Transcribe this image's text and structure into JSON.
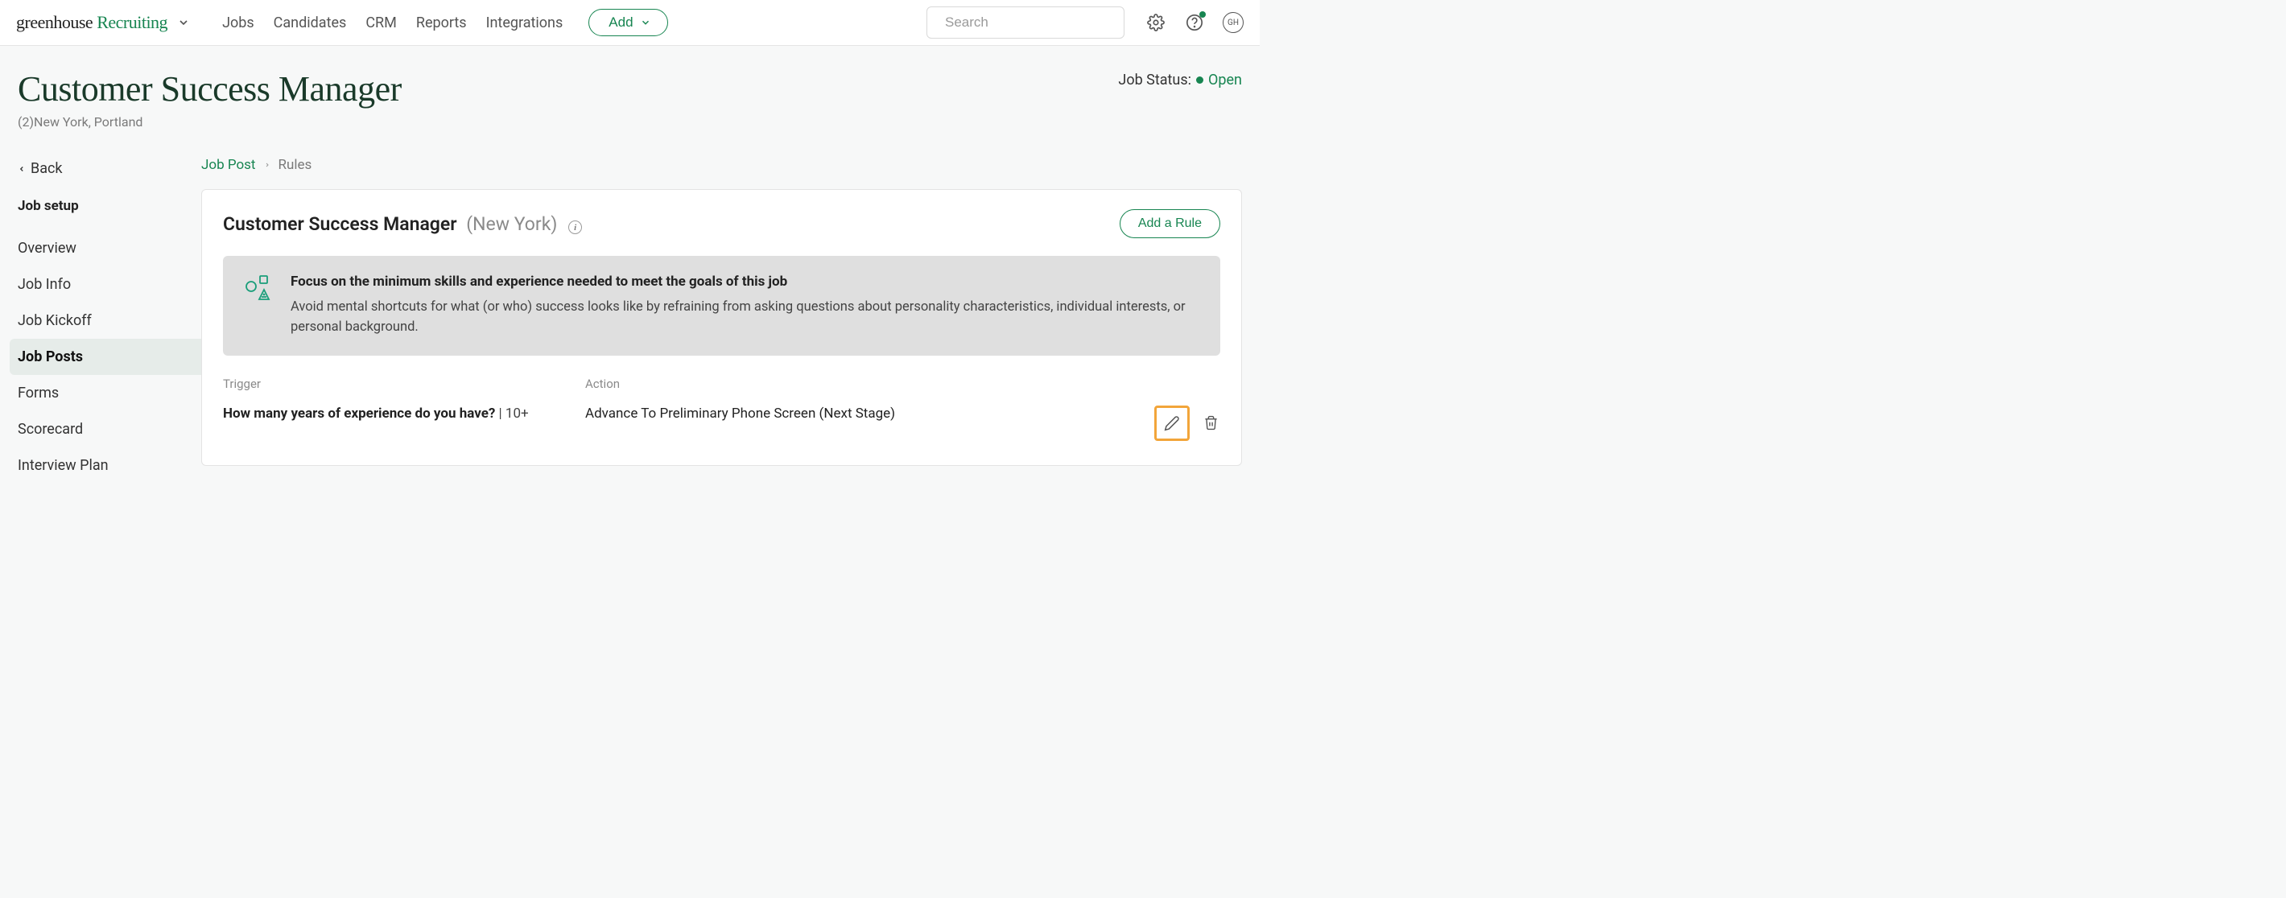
{
  "logo": {
    "word1": "greenhouse",
    "word2": "Recruiting"
  },
  "nav": {
    "jobs": "Jobs",
    "candidates": "Candidates",
    "crm": "CRM",
    "reports": "Reports",
    "integrations": "Integrations"
  },
  "add_button": "Add",
  "search": {
    "placeholder": "Search"
  },
  "avatar": "GH",
  "page": {
    "title": "Customer Success Manager",
    "subtitle": "(2)New York, Portland",
    "status_label": "Job Status:",
    "status_value": "Open"
  },
  "sidebar": {
    "back": "Back",
    "section": "Job setup",
    "items": [
      "Overview",
      "Job Info",
      "Job Kickoff",
      "Job Posts",
      "Forms",
      "Scorecard",
      "Interview Plan"
    ],
    "active_index": 3
  },
  "breadcrumb": {
    "parent": "Job Post",
    "current": "Rules"
  },
  "card": {
    "title": "Customer Success Manager",
    "location": "(New York)",
    "add_rule": "Add a Rule"
  },
  "note": {
    "title": "Focus on the minimum skills and experience needed to meet the goals of this job",
    "body": "Avoid mental shortcuts for what (or who) success looks like by refraining from asking questions about personality characteristics, individual interests, or personal background."
  },
  "rules": {
    "columns": {
      "trigger": "Trigger",
      "action": "Action"
    },
    "items": [
      {
        "question": "How many years of experience do you have?",
        "value": " | 10+",
        "action": "Advance To Preliminary Phone Screen (Next Stage)"
      }
    ]
  }
}
